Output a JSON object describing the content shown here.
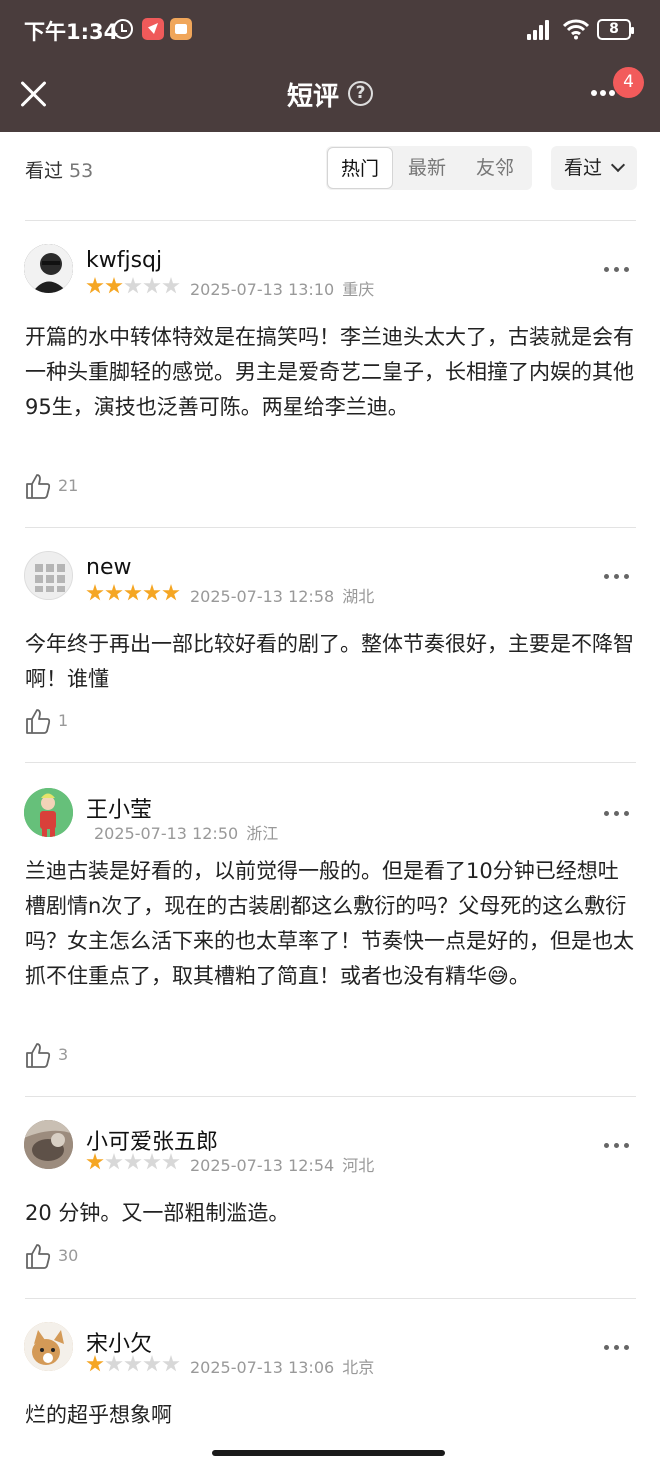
{
  "status_bar": {
    "time": "下午1:34",
    "battery": "8"
  },
  "nav": {
    "title": "短评",
    "help_icon": "?",
    "notification_count": "4"
  },
  "filter": {
    "seen_label": "看过",
    "seen_count": "53",
    "tabs": [
      "热门",
      "最新",
      "友邻"
    ],
    "active_tab": "热门",
    "sort_label": "看过"
  },
  "colors": {
    "header_bg": "#4a3d3d",
    "star_on": "#f5a623",
    "badge": "#f25b5b"
  },
  "reviews": [
    {
      "user": "kwfjsqj",
      "rating": 2,
      "date": "2025-07-13 13:10",
      "location": "重庆",
      "text": "开篇的水中转体特效是在搞笑吗！李兰迪头太大了，古装就是会有一种头重脚轻的感觉。男主是爱奇艺二皇子，长相撞了内娱的其他95生，演技也泛善可陈。两星给李兰迪。",
      "likes": "21"
    },
    {
      "user": "new",
      "rating": 5,
      "date": "2025-07-13 12:58",
      "location": "湖北",
      "text": "今年终于再出一部比较好看的剧了。整体节奏很好，主要是不降智啊！谁懂",
      "likes": "1"
    },
    {
      "user": "王小莹",
      "rating": 0,
      "date": "2025-07-13 12:50",
      "location": "浙江",
      "text": "兰迪古装是好看的，以前觉得一般的。但是看了10分钟已经想吐槽剧情n次了，现在的古装剧都这么敷衍的吗？父母死的这么敷衍吗？女主怎么活下来的也太草率了！节奏快一点是好的，但是也太抓不住重点了，取其槽粕了简直！或者也没有精华😅。",
      "likes": "3"
    },
    {
      "user": "小可爱张五郎",
      "rating": 1,
      "date": "2025-07-13 12:54",
      "location": "河北",
      "text": "20 分钟。又一部粗制滥造。",
      "likes": "30"
    },
    {
      "user": "宋小欠",
      "rating": 1,
      "date": "2025-07-13 13:06",
      "location": "北京",
      "text": "烂的超乎想象啊",
      "likes": ""
    }
  ]
}
